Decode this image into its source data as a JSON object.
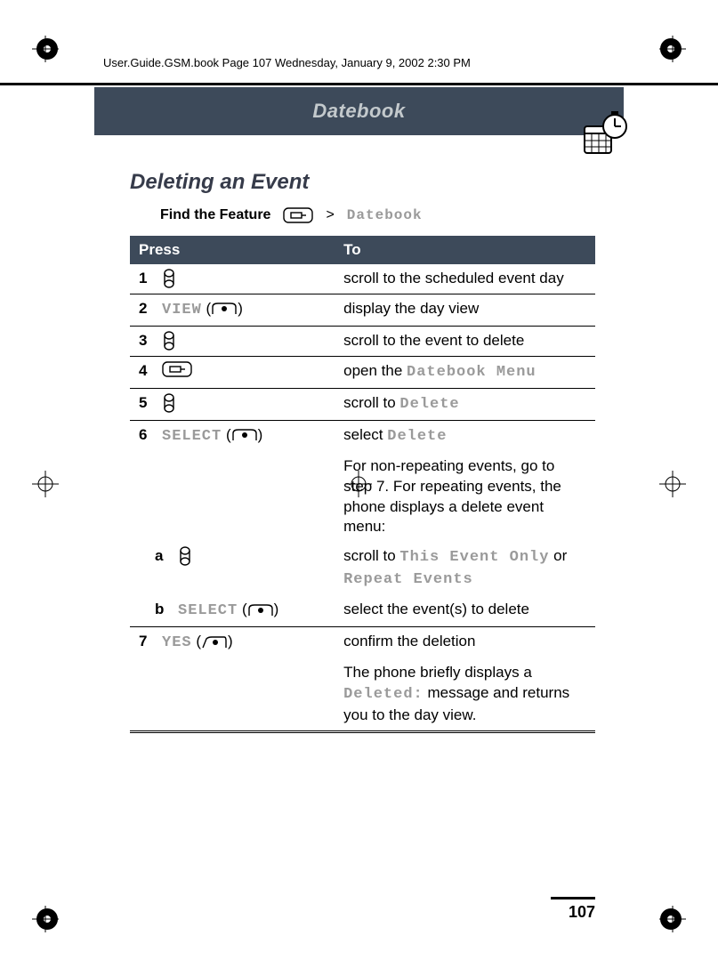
{
  "meta": {
    "running_header": "User.Guide.GSM.book  Page 107  Wednesday, January 9, 2002  2:30 PM"
  },
  "banner": {
    "title": "Datebook"
  },
  "section_title": "Deleting an Event",
  "feature": {
    "label": "Find the Feature",
    "gt": ">",
    "target": "Datebook"
  },
  "table": {
    "head_press": "Press",
    "head_to": "To",
    "rows": [
      {
        "n": "1",
        "press_text": "",
        "icon": "scroll",
        "to": "scroll to the scheduled event day"
      },
      {
        "n": "2",
        "press_ui": "VIEW",
        "press_paren": " (",
        "press_paren2": ")",
        "icon": "softdot",
        "to": "display the day view"
      },
      {
        "n": "3",
        "press_text": "",
        "icon": "scroll",
        "to": "scroll to the event to delete"
      },
      {
        "n": "4",
        "press_text": "",
        "icon": "menukey",
        "to_prefix": "open the ",
        "to_ui": "Datebook Menu"
      },
      {
        "n": "5",
        "press_text": "",
        "icon": "scroll",
        "to_prefix": "scroll to ",
        "to_ui": "Delete"
      },
      {
        "n": "6",
        "press_ui": "SELECT",
        "press_paren": " (",
        "press_paren2": ")",
        "icon": "softdot",
        "to_prefix": "select ",
        "to_ui": "Delete"
      },
      {
        "note": "For non-repeating events, go to step 7. For repeating events, the phone displays a delete event menu:"
      },
      {
        "n": "a",
        "sub": true,
        "icon": "scroll",
        "to_prefix": "scroll to ",
        "to_ui": "This Event Only",
        "to_mid": " or ",
        "to_ui2": "Repeat Events"
      },
      {
        "n": "b",
        "sub": true,
        "press_ui": "SELECT",
        "press_paren": " (",
        "press_paren2": ")",
        "icon": "softdot",
        "to": "select the event(s) to delete"
      },
      {
        "n": "7",
        "press_ui": "YES",
        "press_paren": " (",
        "press_paren2": ")",
        "icon": "softleft",
        "to": "confirm the deletion"
      },
      {
        "note_prefix": "The phone briefly displays a ",
        "note_ui": "Deleted:",
        "note_suffix": " message and returns you to the day view."
      }
    ]
  },
  "page_number": "107"
}
